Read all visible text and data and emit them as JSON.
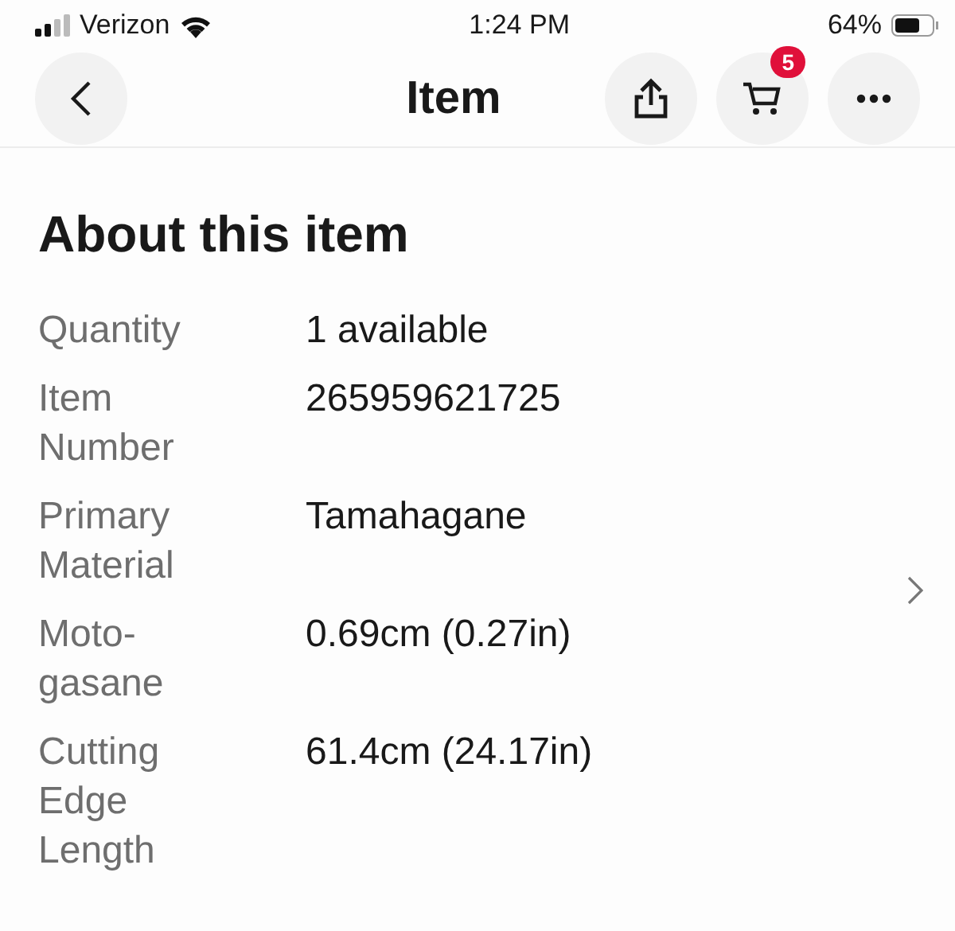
{
  "status_bar": {
    "carrier": "Verizon",
    "time": "1:24 PM",
    "battery": "64%"
  },
  "header": {
    "title": "Item",
    "cart_count": "5"
  },
  "section": {
    "title": "About this item",
    "rows": [
      {
        "label": "Quantity",
        "value": "1 available"
      },
      {
        "label": "Item Number",
        "value": "265959621725"
      },
      {
        "label": "Primary Material",
        "value": "Tamahagane"
      },
      {
        "label": "Moto-gasane",
        "value": "0.69cm (0.27in)"
      },
      {
        "label": "Cutting Edge Length",
        "value": "61.4cm (24.17in)"
      }
    ]
  }
}
